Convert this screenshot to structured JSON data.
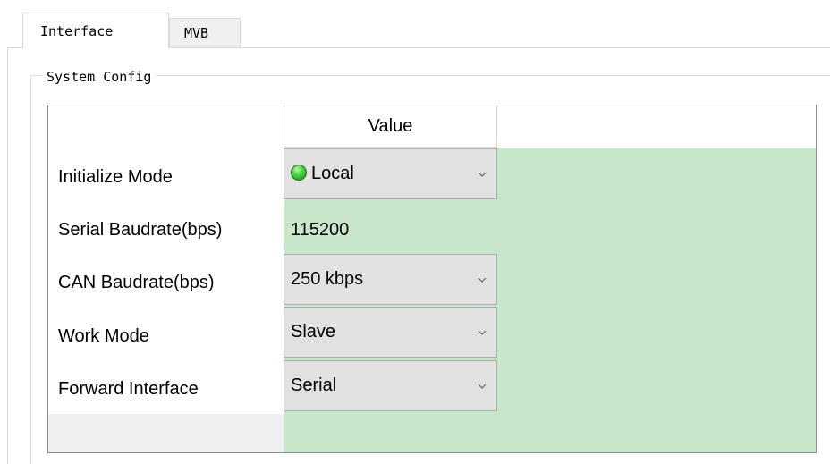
{
  "tabs": [
    {
      "label": "Interface",
      "active": true
    },
    {
      "label": "MVB",
      "active": false
    }
  ],
  "group": {
    "title": "System Config"
  },
  "grid": {
    "column_header": "Value",
    "rows": [
      {
        "label": "Initialize Mode",
        "value": "Local",
        "editor": "combo",
        "status_icon": "green-led-icon"
      },
      {
        "label": "Serial Baudrate(bps)",
        "value": "115200",
        "editor": "text"
      },
      {
        "label": "CAN Baudrate(bps)",
        "value": "250 kbps",
        "editor": "combo"
      },
      {
        "label": "Work Mode",
        "value": "Slave",
        "editor": "combo"
      },
      {
        "label": "Forward Interface",
        "value": "Serial",
        "editor": "combo"
      }
    ]
  },
  "colors": {
    "value_background": "#c8e6c9",
    "combo_background": "#e1e1e1",
    "status_led": "#3fd23a"
  }
}
